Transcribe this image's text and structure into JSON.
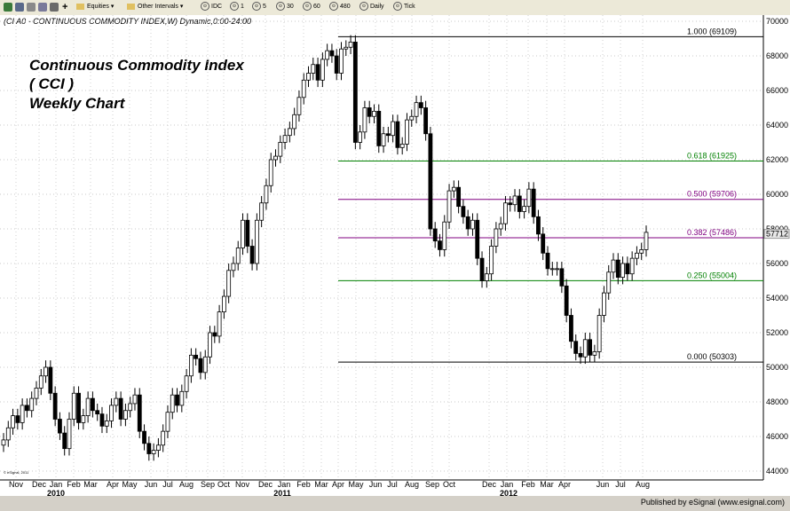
{
  "toolbar": {
    "items": [
      "Equities",
      "Other Intervals",
      "IDC",
      "1",
      "5",
      "30",
      "60",
      "480",
      "Daily",
      "Tick"
    ]
  },
  "header": {
    "symbol_line": "(CI A0 - CONTINUOUS COMMODITY INDEX,W) Dynamic,0:00-24:00"
  },
  "chart_title": [
    "Continuous Commodity Index",
    "( CCI )",
    "Weekly Chart"
  ],
  "watermark": "© eSignal, 2011",
  "footer": {
    "published": "Published by eSignal (www.esignal.com)"
  },
  "colors": {
    "candle_up": "#ffffff",
    "candle_down": "#000000",
    "fib_green": "#008000",
    "fib_purple": "#800080",
    "fib_black": "#000000",
    "last_price_bg": "#e8e8e8"
  },
  "chart_data": {
    "type": "candlestick",
    "title": "Continuous Commodity Index ( CCI ) Weekly Chart",
    "ylim": [
      44000,
      70000
    ],
    "y_ticks": [
      "44000",
      "46000",
      "48000",
      "50000",
      "52000",
      "54000",
      "56000",
      "58000",
      "60000",
      "62000",
      "64000",
      "66000",
      "68000",
      "70000"
    ],
    "x_month_labels": [
      "Nov",
      "Dec",
      "Jan",
      "Feb",
      "Mar",
      "Apr",
      "May",
      "Jun",
      "Jul",
      "Aug",
      "Sep",
      "Oct",
      "Nov",
      "Dec",
      "Jan",
      "Feb",
      "Mar",
      "Apr",
      "May",
      "Jun",
      "Jul",
      "Aug",
      "Sep",
      "Oct",
      "Dec",
      "Jan",
      "Feb",
      "Mar",
      "Apr",
      "Jun",
      "Jul",
      "Aug"
    ],
    "x_year_labels": [
      "2010",
      "2011",
      "2012"
    ],
    "last_price": "57712",
    "fib_levels": [
      {
        "label": "1.000 (69109)",
        "value": 69109,
        "color": "#000000"
      },
      {
        "label": "0.618 (61925)",
        "value": 61925,
        "color": "#008000"
      },
      {
        "label": "0.500 (59706)",
        "value": 59706,
        "color": "#800080"
      },
      {
        "label": "0.382 (57486)",
        "value": 57486,
        "color": "#800080"
      },
      {
        "label": "0.250 (55004)",
        "value": 55004,
        "color": "#008000"
      },
      {
        "label": "0.000 (50303)",
        "value": 50303,
        "color": "#000000"
      }
    ],
    "closes": [
      45800,
      46500,
      47200,
      46800,
      47800,
      47500,
      48200,
      48800,
      49500,
      50000,
      48500,
      47000,
      46200,
      45300,
      47000,
      48500,
      46800,
      47200,
      48200,
      47500,
      47300,
      46600,
      46900,
      47800,
      48200,
      47000,
      47500,
      47900,
      48400,
      46300,
      45600,
      45000,
      45200,
      45500,
      46300,
      47400,
      48400,
      47800,
      48600,
      49500,
      50700,
      50500,
      49700,
      50600,
      52000,
      51800,
      53200,
      54100,
      55600,
      56000,
      56900,
      58500,
      57000,
      56000,
      58500,
      59500,
      60500,
      62000,
      62200,
      63000,
      63400,
      63800,
      64600,
      65600,
      66600,
      67000,
      67500,
      66600,
      67800,
      68300,
      68000,
      67000,
      68400,
      68500,
      68800,
      63000,
      63600,
      65000,
      64500,
      64800,
      62800,
      63500,
      63400,
      64200,
      62700,
      62900,
      64300,
      64500,
      65300,
      65000,
      63500,
      58000,
      57300,
      56800,
      58400,
      60200,
      60400,
      59300,
      58700,
      58000,
      58500,
      56300,
      55000,
      55400,
      57000,
      58000,
      58300,
      59500,
      59400,
      59900,
      59000,
      59300,
      60300,
      58700,
      57700,
      56600,
      55700,
      55700,
      55700,
      54700,
      53000,
      51500,
      50800,
      50600,
      51600,
      50700,
      50900,
      53000,
      54300,
      55500,
      56200,
      55200,
      56000,
      55400,
      56300,
      56600,
      56800,
      57800
    ]
  }
}
